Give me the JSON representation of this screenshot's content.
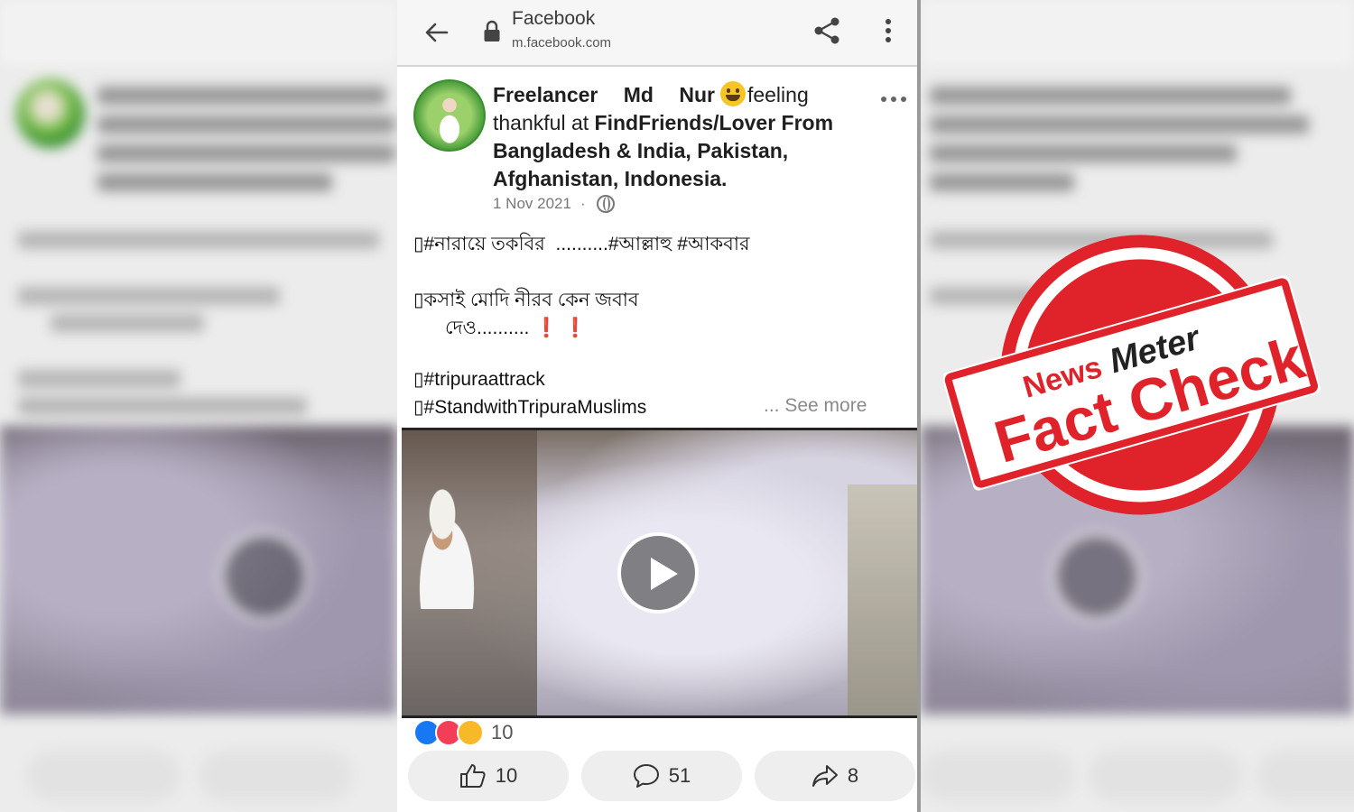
{
  "browser": {
    "site_title": "Facebook",
    "url": "m.facebook.com"
  },
  "post": {
    "author": "Freelancer Md Nur",
    "feeling_text": "feeling",
    "line2_prefix": "thankful at",
    "location_part1": "FindFriends/Lover From",
    "location_line2": "Bangladesh & India, Pakistan,",
    "location_line3": "Afghanistan, Indonesia.",
    "date": "1 Nov 2021",
    "separator": "·",
    "body_line1": "▯#নারায়ে তকবির  ..........#আল্লাহু #আকবার",
    "body_line2": "▯কসাই মোদি নীরব কেন জবাব",
    "body_line3": "      দেও.......... ❗ ❗",
    "body_line4": "▯#tripuraattrack",
    "body_line5": "▯#StandwithTripuraMuslims",
    "see_more": "... See more"
  },
  "engagement": {
    "reaction_count": "10",
    "like_count": "10",
    "comment_count": "51",
    "share_count": "8"
  },
  "stamp": {
    "brand_news": "News",
    "brand_meter": "Meter",
    "label": "Fact Check",
    "color": "#e0232a"
  },
  "icons": [
    "back-arrow-icon",
    "lock-icon",
    "share-icon",
    "more-vert-icon",
    "more-horiz-icon",
    "globe-icon",
    "like-icon",
    "comment-icon",
    "share-arrow-icon",
    "play-icon"
  ]
}
